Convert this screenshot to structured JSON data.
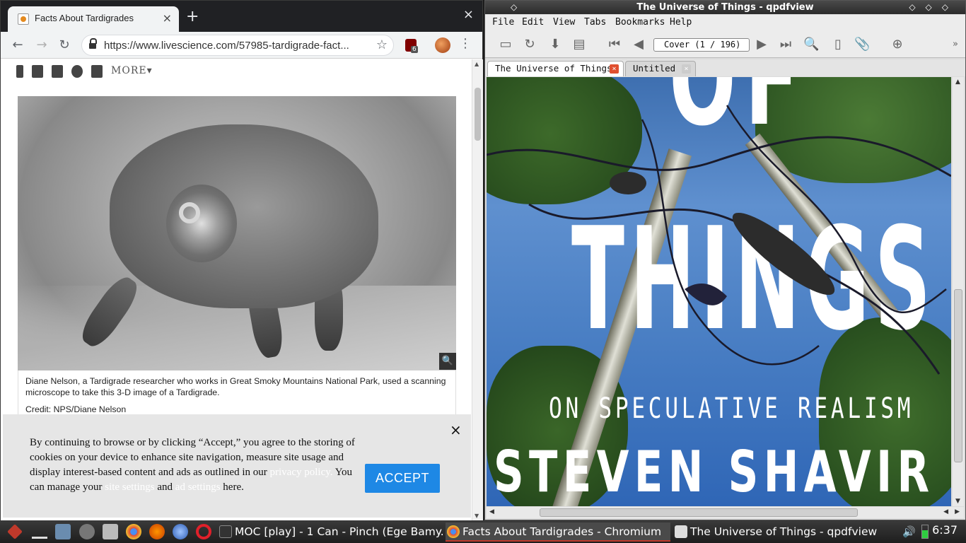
{
  "chromium": {
    "tab_title": "Facts About Tardigrades",
    "tab_close": "×",
    "new_tab": "+",
    "window_close": "×",
    "url": "https://www.livescience.com/57985-tardigrade-fact...",
    "ublock_badge": "6",
    "share_more": "MORE▾",
    "photo_zoom": "🔍",
    "caption": "Diane Nelson, a Tardigrade researcher who works in Great Smoky Mountains National Park, used a scanning microscope to take this 3-D image of a Tardigrade.",
    "credit": "Credit: NPS/Diane Nelson",
    "cookie": {
      "text_1": "By continuing to browse or by clicking “Accept,” you agree to the storing of cookies on your device to enhance site navigation,  measure site usage and display interest-based content and ads as outlined in our ",
      "privacy_link": "privacy policy.",
      "text_2": " You can manage your ",
      "site_settings_link": "site settings",
      "text_3": " and ",
      "ad_settings_link": "ad settings",
      "text_4": " here.",
      "accept_label": "ACCEPT",
      "close": "×"
    }
  },
  "qpdfview": {
    "window_title": "The Universe of Things - qpdfview",
    "menu": [
      "File",
      "Edit",
      "View",
      "Tabs",
      "Bookmarks",
      "Help"
    ],
    "page_indicator": "Cover (1 / 196)",
    "tabs": [
      {
        "label": "The Universe of Things",
        "active": true
      },
      {
        "label": "Untitled",
        "active": false
      }
    ],
    "cover": {
      "top_fragment": "OF",
      "title_word": "THINGS",
      "subtitle": "ON SPECULATIVE REALISM",
      "author": "STEVEN SHAVIR"
    }
  },
  "taskbar": {
    "tasks": [
      {
        "label": "MOC [play] - 1 Can - Pinch (Ege Bamy..."
      },
      {
        "label": "Facts About Tardigrades - Chromium"
      },
      {
        "label": "The Universe of Things - qpdfview"
      }
    ],
    "clock": "6:37"
  },
  "colors": {
    "accept_button": "#1e88e5",
    "taskbar": "#2a2a2a",
    "qpdf_tab_close": "#e05030"
  }
}
